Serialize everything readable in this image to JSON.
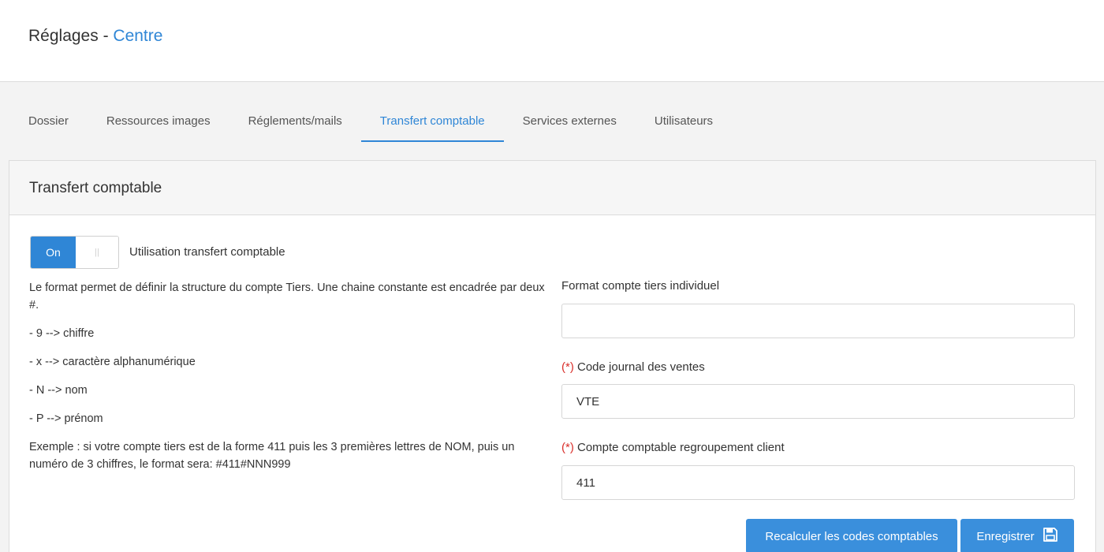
{
  "header": {
    "title_prefix": "Réglages",
    "separator": " - ",
    "title_accent": "Centre"
  },
  "tabs": [
    {
      "label": "Dossier"
    },
    {
      "label": "Ressources images"
    },
    {
      "label": "Réglements/mails"
    },
    {
      "label": "Transfert comptable",
      "active": true
    },
    {
      "label": "Services externes"
    },
    {
      "label": "Utilisateurs"
    }
  ],
  "panel": {
    "title": "Transfert comptable",
    "toggle": {
      "on_label": "On",
      "handle_glyph": "||",
      "state": "on"
    },
    "toggle_label": "Utilisation transfert comptable",
    "help": [
      "Le format permet de définir la structure du compte Tiers. Une chaine constante est encadrée par deux #.",
      "- 9 --> chiffre",
      "- x --> caractère alphanumérique",
      "- N --> nom",
      "- P --> prénom",
      "Exemple : si votre compte tiers est de la forme 411 puis les 3 premières lettres de NOM, puis un numéro de 3 chiffres, le format sera: #411#NNN999"
    ],
    "fields": {
      "format_label": "Format compte tiers individuel",
      "format_value": "",
      "required_marker": "(*)",
      "journal_label": "Code journal des ventes",
      "journal_value": "VTE",
      "compte_label": "Compte comptable regroupement client",
      "compte_value": "411"
    },
    "buttons": {
      "recalc_label": "Recalculer les codes comptables",
      "save_label": "Enregistrer",
      "save_icon": "floppy-disk-icon"
    }
  },
  "colors": {
    "accent": "#2f86d6",
    "button": "#3a8fdc",
    "required": "#d9302c"
  }
}
